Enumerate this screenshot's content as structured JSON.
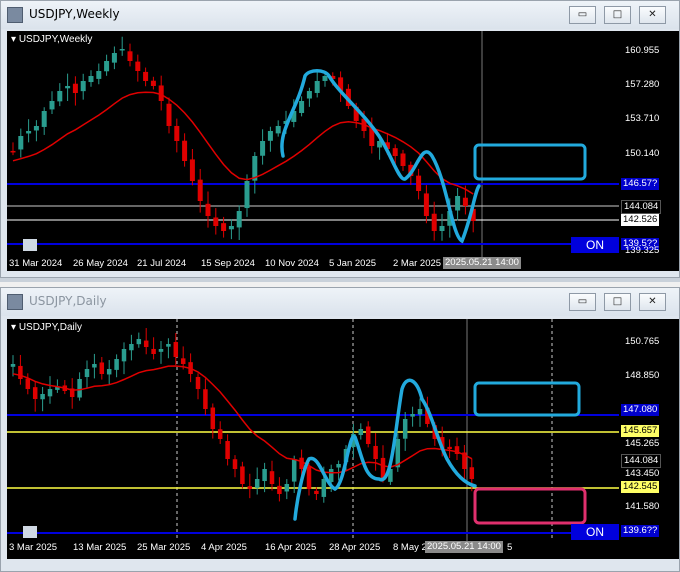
{
  "windows": [
    {
      "title": "USDJPY,Weekly",
      "header": "USDJPY,Weekly",
      "active": true,
      "price_ticks": [
        "160.955",
        "157.280",
        "153.710",
        "150.140",
        "146.570",
        "142.526",
        "139.325"
      ],
      "tags": [
        {
          "text": "146.57?",
          "bg": "#0000cc",
          "fg": "#ffffff"
        },
        {
          "text": "144.084",
          "bg": "#000000",
          "fg": "#ffffff"
        },
        {
          "text": "142.526",
          "bg": "#ffffff",
          "fg": "#000000"
        },
        {
          "text": "139.5??",
          "bg": "#0000cc",
          "fg": "#ffffff"
        }
      ],
      "time_ticks": [
        "31 Mar 2024",
        "26 May 2024",
        "21 Jul 2024",
        "15 Sep 2024",
        "10 Nov 2024",
        "5 Jan 2025",
        "2 Mar 2025"
      ],
      "cursor_time": "2025.05.21 14:00",
      "on_label": "ON"
    },
    {
      "title": "USDJPY,Daily",
      "header": "USDJPY,Daily",
      "active": false,
      "price_ticks": [
        "150.765",
        "148.850",
        "147.080",
        "145.265",
        "143.450",
        "141.580",
        "139.6??"
      ],
      "tags": [
        {
          "text": "147.080",
          "bg": "#0000cc",
          "fg": "#ffffff"
        },
        {
          "text": "145.657",
          "bg": "#ffff66",
          "fg": "#000000"
        },
        {
          "text": "144.084",
          "bg": "#000000",
          "fg": "#ffffff"
        },
        {
          "text": "142.545",
          "bg": "#ffff66",
          "fg": "#000000"
        },
        {
          "text": "139.6??",
          "bg": "#0000cc",
          "fg": "#ffffff"
        }
      ],
      "time_ticks": [
        "3 Mar 2025",
        "13 Mar 2025",
        "25 Mar 2025",
        "4 Apr 2025",
        "16 Apr 2025",
        "28 Apr 2025",
        "8 May 2"
      ],
      "cursor_time": "2025.05.21 14:00",
      "time_tail": "5",
      "on_label": "ON"
    }
  ],
  "window_buttons": {
    "minimize": "▭",
    "maximize": "□",
    "close": "✕"
  },
  "colors": {
    "bull": "#2a9d8f",
    "bear": "#e00000",
    "ma": "#e00000",
    "hand": "#22aadd",
    "blue_line": "#0000dd",
    "yellow_line": "#ffff44",
    "pink_box": "#e0306e"
  }
}
